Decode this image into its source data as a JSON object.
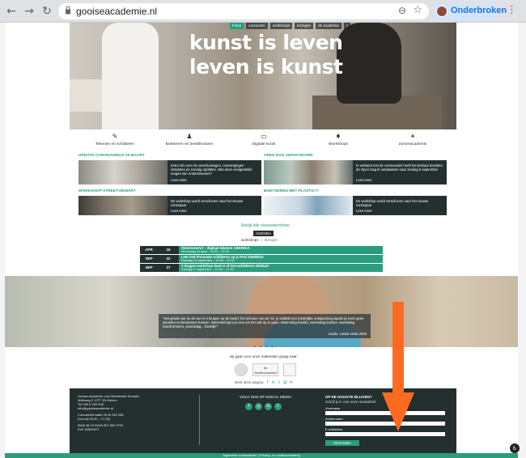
{
  "browser": {
    "url": "gooiseacademie.nl",
    "profile_label": "Onderbroken",
    "back_icon": "←",
    "forward_icon": "→",
    "reload_icon": "↻",
    "zoom_icon": "⊖",
    "star_icon": "☆",
    "menu_icon": "⋮"
  },
  "nav": {
    "items": [
      "home",
      "cursussen",
      "workshops",
      "lezingen",
      "de academie"
    ],
    "search_icon": "⌕"
  },
  "hero": {
    "line1": "kunst is leven",
    "line2": "leven is kunst"
  },
  "categories": [
    {
      "label": "Tekenen en schilderen",
      "icon": "✎"
    },
    {
      "label": "Boetseren en beeldhouwen",
      "icon": "♟"
    },
    {
      "label": "Digitale kunst",
      "icon": "▭"
    },
    {
      "label": "Workshops",
      "icon": "♦"
    },
    {
      "label": "Zomeracademie",
      "icon": "☀"
    }
  ],
  "news": [
    {
      "title": "UPDATE CORONAVIRUS 19 MAART",
      "text": "Extra info over de verschuivingen, overwegingen instanties en zondag opdatten. Wat doen veelgestelde vragen van ondersteuners?",
      "more": "Lees meer"
    },
    {
      "title": "OPEN DAG VERSCHOVEN",
      "text": "In verband met de coronacrisis heeft het bestuur besloten de Open Dag te verplaatsen naar zondag 6 september",
      "more": "Lees meer"
    },
    {
      "title": "WORKSHOP STREETVIEWART",
      "text": "De workshop wordt verschoven naar het nieuwe cursusjaar",
      "more": "Lees meer"
    },
    {
      "title": "BOETSEREN MET PLASTIC?!",
      "text": "De workshop wordt verschoven naar het nieuwe cursusjaar",
      "more": "Lees meer"
    }
  ],
  "all_news_link": "Bekijk alle nieuwsberichten",
  "agenda": {
    "badge": "AGENDA",
    "tab_workshops": "workshops",
    "tab_sep": "|",
    "tab_lezingen": "lezingen",
    "rows": [
      {
        "month": "APR",
        "day": "15",
        "title": "StreetviewArt – digitaal tekenen 13HHWnA",
        "sub": "Woensdag 15 april – 19.30 – 22.30"
      },
      {
        "month": "SEP",
        "day": "22",
        "title": "Leer met Procreate schilderen op je iPad 23HSDUU",
        "sub": "Dinsdag 22 september – 19.30 – 22.30"
      },
      {
        "month": "SEP",
        "day": "27",
        "title": "2-daagse workshop Sumi-e of Zen-schilderen 20SIZuH",
        "sub": "Zondag 27 september – 13.30 – 17.30"
      }
    ]
  },
  "quote": {
    "text": "\"Het geluid van de de van m s kruipen op de bedel; het schuren van de rol; je ontdekt een feestelijke ontspanning waarin je even geen woorden en benoemen hoeven. Wezenschap is je ene om het vak op te gaan. Woensdag handel, woensdag boetsel, woensdag transformeren, woensdag... heerlijk!\"",
    "author": "Guido, cursist sinds 2008",
    "dots": "• • • •"
  },
  "partners": {
    "text": "wij gaan voor onze materialen graag naar:",
    "logo2": "De Beeldhouwwinkel",
    "share_label": "Deel deze pagina:",
    "share_icons": [
      "f",
      "in",
      "t",
      "@",
      "✉"
    ]
  },
  "footer": {
    "org_lines": [
      "Gooise Academie voor Beeldende Kunsten",
      "Melkweg 2 1277 JN Huizen",
      "Tel 035 6 263 268",
      "info@gooiseacademie.nl"
    ],
    "info_lines": [
      "Cursusinformatie 06 40 819 981",
      "(ma-vrij 09.30 – 17.00)"
    ],
    "bank_lines": [
      "IBAN NL76 INGB 067 800 2791",
      "KvK 40509972"
    ],
    "social_title": "VOLG ONS OP SOCIAL MEDIA",
    "social_icons": [
      "f",
      "◎",
      "in",
      "t"
    ],
    "newsletter_title": "OP DE HOOGTE BLIJVEN?",
    "newsletter_sub": "Schrijf je in voor onze nieuwsbrief",
    "label_first": "Voornaam",
    "label_last": "Achternaam",
    "label_email": "E-mailadres",
    "submit": "Verzenden",
    "bottom": "Algemene voorwaarden  |  Privacy- en cookieverklaring"
  },
  "colors": {
    "accent": "#2a9d7c",
    "dark": "#23302f",
    "arrow": "#ff6a21"
  }
}
